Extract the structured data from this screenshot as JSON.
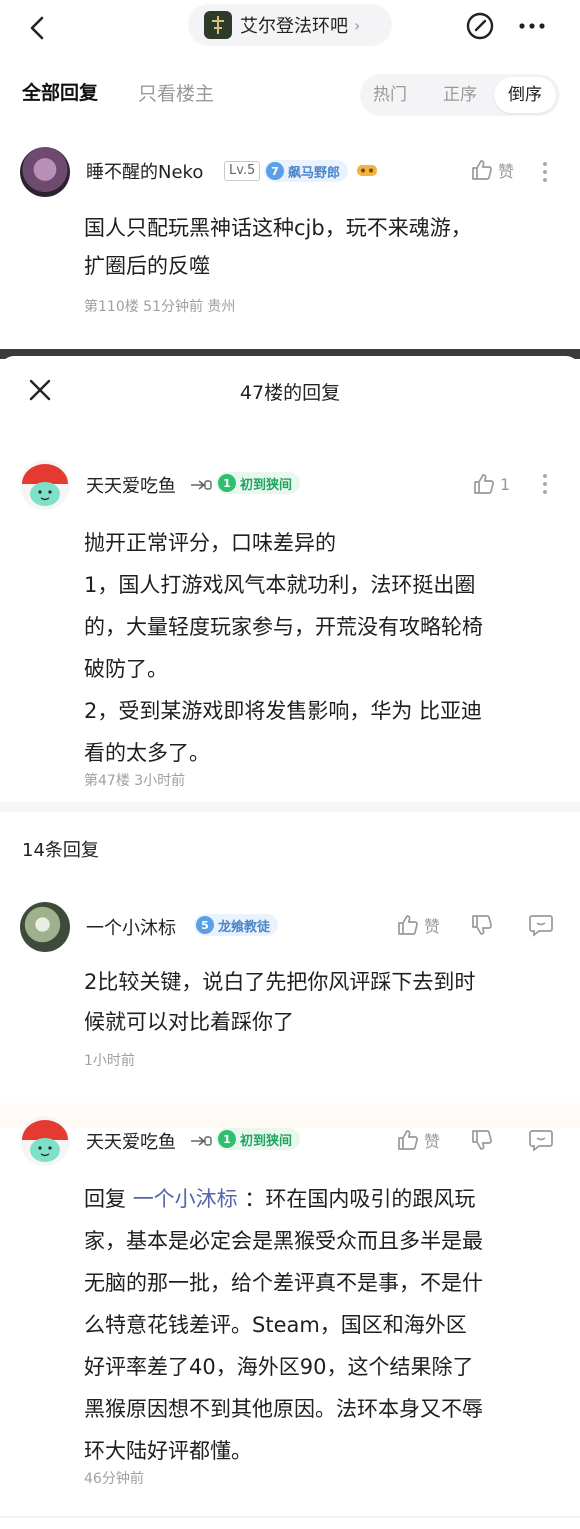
{
  "nav": {
    "forum_name": "艾尔登法环吧",
    "chevron": "›"
  },
  "tabs": {
    "all": "全部回复",
    "owner_only": "只看楼主"
  },
  "sort": {
    "hot": "热门",
    "asc": "正序",
    "desc": "倒序",
    "selected": "倒序"
  },
  "post_top": {
    "username": "睡不醒的Neko",
    "level": "Lv.5",
    "badge_num": "7",
    "badge_text": "飙马野郎",
    "badge_color": "#5aa0e8",
    "like_label": "赞",
    "lines": [
      "国人只配玩黑神话这种cjb，玩不来魂游，",
      "扩圈后的反噬"
    ],
    "meta": "第110楼  51分钟前  贵州"
  },
  "sheet": {
    "title": "47楼的回复"
  },
  "post_47": {
    "username": "天天爱吃鱼",
    "badge_num": "1",
    "badge_text": "初到狭间",
    "badge_color": "#2fbf71",
    "like_count": "1",
    "lines": [
      "抛开正常评分，口味差异的",
      "1，国人打游戏风气本就功利，法环挺出圈",
      "的，大量轻度玩家参与，开荒没有攻略轮椅",
      "破防了。",
      "2，受到某游戏即将发售影响，华为 比亚迪",
      "看的太多了。"
    ],
    "meta": "第47楼  3小时前"
  },
  "replies_header": "14条回复",
  "reply_1": {
    "username": "一个小沐标",
    "badge_num": "5",
    "badge_text": "龙飨教徒",
    "badge_color": "#5aa0e8",
    "like_label": "赞",
    "lines": [
      "2比较关键，说白了先把你风评踩下去到时",
      "候就可以对比着踩你了"
    ],
    "meta": "1小时前"
  },
  "reply_2": {
    "username": "天天爱吃鱼",
    "badge_num": "1",
    "badge_text": "初到狭间",
    "badge_color": "#2fbf71",
    "like_label": "赞",
    "reply_prefix": "回复 ",
    "mention": "一个小沐标",
    "first_line_rest": " ：环在国内吸引的跟风玩",
    "lines": [
      "家，基本是必定会是黑猴受众而且多半是最",
      "无脑的那一批，给个差评真不是事，不是什",
      "么特意花钱差评。Steam，国区和海外区",
      "好评率差了40，海外区90，这个结果除了",
      "黑猴原因想不到其他原因。法环本身又不辱",
      "环大陆好评都懂。"
    ],
    "meta": "46分钟前"
  },
  "colors": {
    "mention": "#5366a8",
    "meta": "#a0a0a0",
    "badge_bg": "#e9f7ef"
  }
}
